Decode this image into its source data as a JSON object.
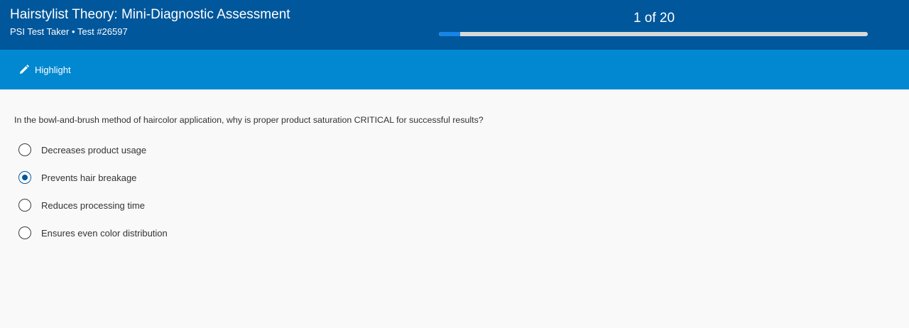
{
  "header": {
    "title": "Hairstylist Theory: Mini-Diagnostic Assessment",
    "subtitle": "PSI Test Taker • Test #26597",
    "progress_label": "1 of 20",
    "progress_fraction": 0.05
  },
  "toolbar": {
    "highlight_label": "Highlight",
    "highlight_icon": "pencil-icon"
  },
  "question": {
    "text": "In the bowl-and-brush method of haircolor application, why is proper product saturation CRITICAL for successful results?",
    "options": [
      {
        "label": "Decreases product usage",
        "selected": false
      },
      {
        "label": "Prevents hair breakage",
        "selected": true
      },
      {
        "label": "Reduces processing time",
        "selected": false
      },
      {
        "label": "Ensures even color distribution",
        "selected": false
      }
    ]
  },
  "colors": {
    "header_bg": "#00579c",
    "toolbar_bg": "#0288d1",
    "progress_fill": "#1784e6",
    "progress_track": "#d9d9d9",
    "page_bg": "#f9f9f9"
  }
}
